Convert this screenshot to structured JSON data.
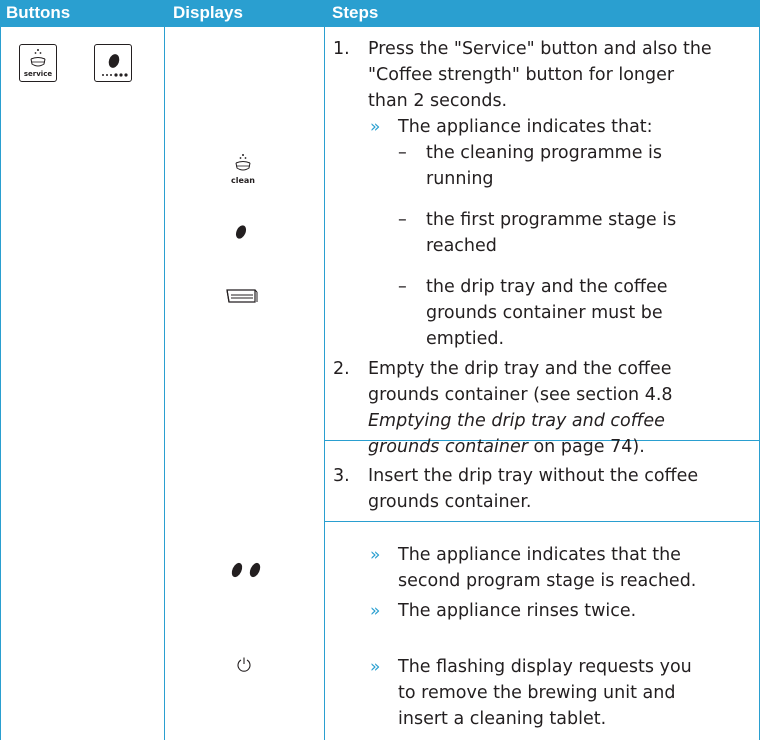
{
  "header": {
    "col_buttons": "Buttons",
    "col_displays": "Displays",
    "col_steps": "Steps"
  },
  "buttons": {
    "service_label": "service",
    "service_icon": "cup-steam-icon",
    "strength_icon": "coffee-bean-strength-icon"
  },
  "displays": {
    "clean_label": "clean",
    "clean_icon": "cup-steam-icon",
    "bean_icon": "coffee-bean-icon",
    "drip_tray_icon": "drip-tray-icon",
    "two_beans_icon": "two-coffee-beans-icon",
    "power_icon": "power-icon"
  },
  "steps": {
    "s1_num": "1.",
    "s1_l1": "Press the \"Service\" button and also the",
    "s1_l2": "\"Coffee strength\" button for longer",
    "s1_l3": "than 2 seconds.",
    "s1_r1": "The appliance indicates that:",
    "s1_d1_l1": "the cleaning programme is",
    "s1_d1_l2": "running",
    "s1_d2_l1": "the first programme stage is",
    "s1_d2_l2": "reached",
    "s1_d3_l1": "the drip tray and the coffee",
    "s1_d3_l2": "grounds container must be",
    "s1_d3_l3": "emptied.",
    "s2_num": "2.",
    "s2_l1": "Empty the drip tray and the coffee",
    "s2_l2": "grounds container (see section  4.8",
    "s2_l3": "Emptying the drip tray and coffee",
    "s2_l4_italic": "grounds container",
    "s2_l4_rest": " on page 74).",
    "s3_num": "3.",
    "s3_l1": "Insert the drip tray without the coffee",
    "s3_l2": "grounds container.",
    "s3_r1_l1": "The appliance indicates that the",
    "s3_r1_l2": "second program stage is reached.",
    "s3_r2": "The appliance rinses twice.",
    "s3_r3_l1": "The flashing display requests you",
    "s3_r3_l2": "to remove the brewing unit and",
    "s3_r3_l3": "insert a cleaning tablet.",
    "arrow_glyph": "»",
    "dash_glyph": "–"
  },
  "colors": {
    "accent": "#2a9fd0",
    "text": "#231f20"
  }
}
